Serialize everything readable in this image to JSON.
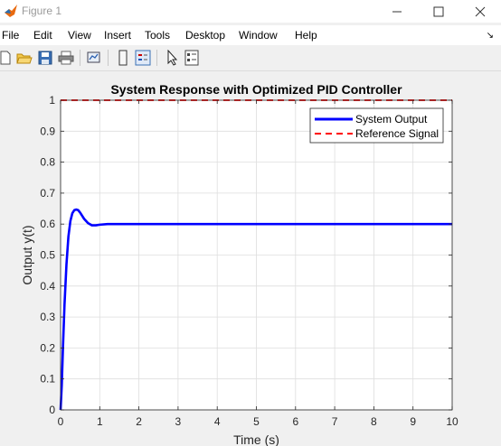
{
  "window": {
    "title": "Figure 1",
    "controls": {
      "minimize": "minimize",
      "maximize": "maximize",
      "close": "close"
    }
  },
  "menubar": {
    "items": [
      "File",
      "Edit",
      "View",
      "Insert",
      "Tools",
      "Desktop",
      "Window",
      "Help"
    ]
  },
  "toolbar": {
    "tools": [
      "new-figure",
      "open-file",
      "save",
      "print",
      "link-plot",
      "colorbar",
      "legend",
      "select-pointer",
      "property-editor"
    ]
  },
  "colors": {
    "output_line": "#0000ff",
    "reference_line": "#ff0000",
    "grid": "#dedede"
  },
  "chart_data": {
    "type": "line",
    "title": "System Response with Optimized PID Controller",
    "xlabel": "Time (s)",
    "ylabel": "Output y(t)",
    "xlim": [
      0,
      10
    ],
    "ylim": [
      0,
      1
    ],
    "xticks": [
      "0",
      "1",
      "2",
      "3",
      "4",
      "5",
      "6",
      "7",
      "8",
      "9",
      "10"
    ],
    "yticks": [
      "0",
      "0.1",
      "0.2",
      "0.3",
      "0.4",
      "0.5",
      "0.6",
      "0.7",
      "0.8",
      "0.9",
      "1"
    ],
    "grid": true,
    "legend_position": "top-right",
    "series": [
      {
        "name": "System Output",
        "style": "solid",
        "x": [
          0,
          0.03,
          0.06,
          0.1,
          0.15,
          0.2,
          0.25,
          0.3,
          0.35,
          0.4,
          0.45,
          0.5,
          0.55,
          0.6,
          0.7,
          0.8,
          0.9,
          1.0,
          1.2,
          1.5,
          2,
          3,
          4,
          5,
          6,
          7,
          8,
          9,
          10
        ],
        "y": [
          0,
          0.08,
          0.2,
          0.34,
          0.47,
          0.56,
          0.61,
          0.635,
          0.645,
          0.647,
          0.645,
          0.637,
          0.627,
          0.617,
          0.603,
          0.596,
          0.596,
          0.598,
          0.6,
          0.6,
          0.6,
          0.6,
          0.6,
          0.6,
          0.6,
          0.6,
          0.6,
          0.6,
          0.6
        ]
      },
      {
        "name": "Reference Signal",
        "style": "dashed",
        "x": [
          0,
          10
        ],
        "y": [
          1,
          1
        ]
      }
    ]
  }
}
